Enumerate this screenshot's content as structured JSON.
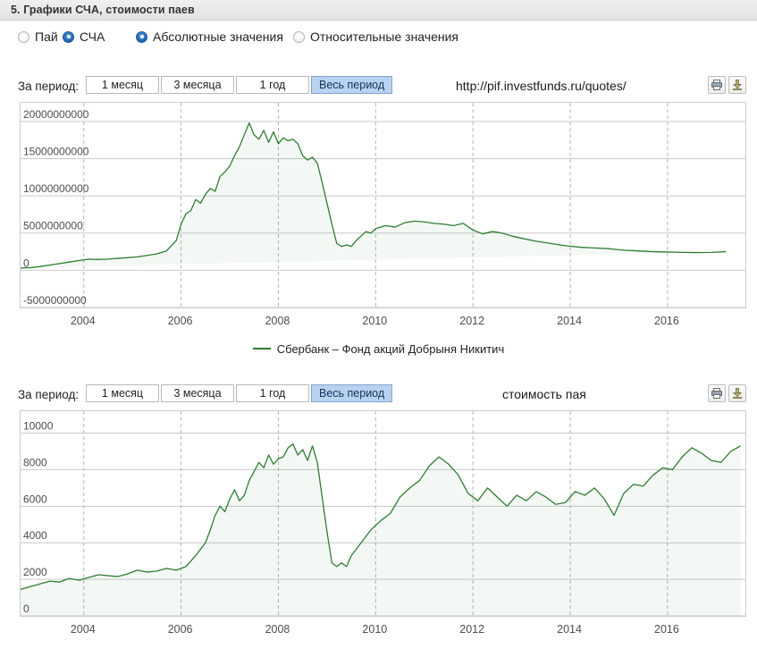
{
  "section": {
    "title": "5. Графики СЧА, стоимости паев"
  },
  "options": [
    {
      "label": "Пай",
      "selected": false,
      "name": "radio-pai"
    },
    {
      "label": "СЧА",
      "selected": true,
      "name": "radio-scha"
    },
    {
      "label": "Абсолютные значения",
      "selected": true,
      "name": "radio-absolute"
    },
    {
      "label": "Относительные значения",
      "selected": false,
      "name": "radio-relative"
    }
  ],
  "toolbar1": {
    "period_label": "За период:",
    "buttons": [
      {
        "label": "1 месяц",
        "active": false
      },
      {
        "label": "3 месяца",
        "active": false
      },
      {
        "label": "1 год",
        "active": false
      },
      {
        "label": "Весь период",
        "active": true
      }
    ],
    "caption": "http://pif.investfunds.ru/quotes/",
    "print_icon": "print-icon",
    "download_icon": "download-icon"
  },
  "toolbar2": {
    "period_label": "За период:",
    "buttons": [
      {
        "label": "1 месяц",
        "active": false
      },
      {
        "label": "3 месяца",
        "active": false
      },
      {
        "label": "1 год",
        "active": false
      },
      {
        "label": "Весь период",
        "active": true
      }
    ],
    "caption": "стоимость пая",
    "print_icon": "print-icon",
    "download_icon": "download-icon"
  },
  "legend": {
    "series_name": "Сбербанк – Фонд акций Добрыня Никитич",
    "color": "#2e7d32"
  },
  "chart_data": [
    {
      "id": "nav-chart",
      "type": "line",
      "title": "",
      "xlabel": "",
      "ylabel": "",
      "series_name": "Сбербанк – Фонд акций Добрыня Никитич",
      "color": "#2e7d32",
      "grid": true,
      "legend_position": "bottom",
      "ylim": [
        -5000000000,
        22500000000
      ],
      "yticks": [
        20000000000,
        15000000000,
        10000000000,
        5000000000,
        0,
        -5000000000
      ],
      "ytick_labels": [
        "20000000000",
        "15000000000",
        "10000000000",
        "5000000000",
        "0",
        "-5000000000"
      ],
      "xlim": [
        2002.7,
        2017.6
      ],
      "xticks": [
        2004,
        2006,
        2008,
        2010,
        2012,
        2014,
        2016
      ],
      "xtick_labels": [
        "2004",
        "2006",
        "2008",
        "2010",
        "2012",
        "2014",
        "2016"
      ],
      "x": [
        2002.7,
        2002.9,
        2003.1,
        2003.3,
        2003.5,
        2003.7,
        2003.9,
        2004.1,
        2004.3,
        2004.5,
        2004.7,
        2004.9,
        2005.1,
        2005.3,
        2005.5,
        2005.7,
        2005.9,
        2006.0,
        2006.1,
        2006.2,
        2006.3,
        2006.4,
        2006.5,
        2006.6,
        2006.7,
        2006.8,
        2006.9,
        2007.0,
        2007.1,
        2007.2,
        2007.3,
        2007.4,
        2007.5,
        2007.6,
        2007.7,
        2007.8,
        2007.9,
        2008.0,
        2008.1,
        2008.2,
        2008.3,
        2008.4,
        2008.5,
        2008.6,
        2008.7,
        2008.8,
        2008.9,
        2009.0,
        2009.1,
        2009.2,
        2009.3,
        2009.4,
        2009.5,
        2009.6,
        2009.7,
        2009.8,
        2009.9,
        2010.0,
        2010.2,
        2010.4,
        2010.6,
        2010.8,
        2011.0,
        2011.2,
        2011.4,
        2011.6,
        2011.8,
        2012.0,
        2012.2,
        2012.4,
        2012.6,
        2012.8,
        2013.0,
        2013.3,
        2013.6,
        2013.9,
        2014.2,
        2014.5,
        2014.8,
        2015.1,
        2015.4,
        2015.7,
        2016.0,
        2016.3,
        2016.6,
        2016.9,
        2017.2,
        2017.5
      ],
      "y": [
        300000000,
        350000000,
        500000000,
        700000000,
        900000000,
        1100000000,
        1300000000,
        1500000000,
        1450000000,
        1500000000,
        1600000000,
        1700000000,
        1800000000,
        2000000000,
        2200000000,
        2600000000,
        4000000000,
        6200000000,
        7600000000,
        8000000000,
        9500000000,
        9000000000,
        10200000000,
        11000000000,
        10600000000,
        12600000000,
        13200000000,
        14000000000,
        15400000000,
        16600000000,
        18200000000,
        19800000000,
        18200000000,
        17600000000,
        18800000000,
        17200000000,
        18600000000,
        17000000000,
        17800000000,
        17400000000,
        17600000000,
        17000000000,
        15400000000,
        14800000000,
        15200000000,
        14400000000,
        11800000000,
        9000000000,
        6200000000,
        3600000000,
        3200000000,
        3400000000,
        3200000000,
        4000000000,
        4600000000,
        5200000000,
        5000000000,
        5600000000,
        6000000000,
        5800000000,
        6400000000,
        6600000000,
        6500000000,
        6300000000,
        6200000000,
        6000000000,
        6300000000,
        5400000000,
        4900000000,
        5200000000,
        5000000000,
        4600000000,
        4300000000,
        3900000000,
        3600000000,
        3300000000,
        3100000000,
        3000000000,
        2900000000,
        2700000000,
        2600000000,
        2500000000,
        2450000000,
        2400000000,
        2380000000,
        2400000000,
        2500000000
      ]
    },
    {
      "id": "unit-price-chart",
      "type": "line",
      "title": "стоимость пая",
      "xlabel": "",
      "ylabel": "",
      "series_name": "Сбербанк – Фонд акций Добрыня Никитич",
      "color": "#2e7d32",
      "grid": true,
      "legend_position": "none",
      "ylim": [
        0,
        11200
      ],
      "yticks": [
        10000,
        8000,
        6000,
        4000,
        2000,
        0
      ],
      "ytick_labels": [
        "10000",
        "8000",
        "6000",
        "4000",
        "2000",
        "0"
      ],
      "xlim": [
        2002.7,
        2017.6
      ],
      "xticks": [
        2004,
        2006,
        2008,
        2010,
        2012,
        2014,
        2016
      ],
      "xtick_labels": [
        "2004",
        "2006",
        "2008",
        "2010",
        "2012",
        "2014",
        "2016"
      ],
      "x": [
        2002.7,
        2002.9,
        2003.1,
        2003.3,
        2003.5,
        2003.7,
        2003.9,
        2004.1,
        2004.3,
        2004.5,
        2004.7,
        2004.9,
        2005.1,
        2005.3,
        2005.5,
        2005.7,
        2005.9,
        2006.1,
        2006.3,
        2006.5,
        2006.6,
        2006.7,
        2006.8,
        2006.9,
        2007.0,
        2007.1,
        2007.2,
        2007.3,
        2007.4,
        2007.5,
        2007.6,
        2007.7,
        2007.8,
        2007.9,
        2008.0,
        2008.1,
        2008.2,
        2008.3,
        2008.4,
        2008.5,
        2008.6,
        2008.7,
        2008.8,
        2008.9,
        2009.0,
        2009.1,
        2009.2,
        2009.3,
        2009.4,
        2009.5,
        2009.7,
        2009.9,
        2010.1,
        2010.3,
        2010.5,
        2010.7,
        2010.9,
        2011.1,
        2011.3,
        2011.5,
        2011.7,
        2011.9,
        2012.1,
        2012.3,
        2012.5,
        2012.7,
        2012.9,
        2013.1,
        2013.3,
        2013.5,
        2013.7,
        2013.9,
        2014.1,
        2014.3,
        2014.5,
        2014.7,
        2014.9,
        2015.1,
        2015.3,
        2015.5,
        2015.7,
        2015.9,
        2016.1,
        2016.3,
        2016.5,
        2016.7,
        2016.9,
        2017.1,
        2017.3,
        2017.5
      ],
      "y": [
        1450,
        1600,
        1750,
        1900,
        1850,
        2050,
        1950,
        2100,
        2250,
        2200,
        2150,
        2300,
        2500,
        2400,
        2450,
        2600,
        2500,
        2700,
        3300,
        4000,
        4700,
        5500,
        6000,
        5700,
        6400,
        6900,
        6300,
        6600,
        7400,
        7900,
        8400,
        8100,
        8800,
        8300,
        8600,
        8700,
        9200,
        9400,
        8800,
        9100,
        8500,
        9300,
        8400,
        6500,
        4600,
        2900,
        2700,
        2900,
        2700,
        3300,
        4000,
        4700,
        5200,
        5600,
        6500,
        7000,
        7400,
        8200,
        8700,
        8300,
        7700,
        6700,
        6300,
        7000,
        6500,
        6000,
        6600,
        6300,
        6800,
        6500,
        6100,
        6200,
        6800,
        6600,
        7000,
        6400,
        5500,
        6700,
        7200,
        7100,
        7700,
        8100,
        8000,
        8700,
        9200,
        8900,
        8500,
        8400,
        9000,
        9300
      ]
    }
  ]
}
